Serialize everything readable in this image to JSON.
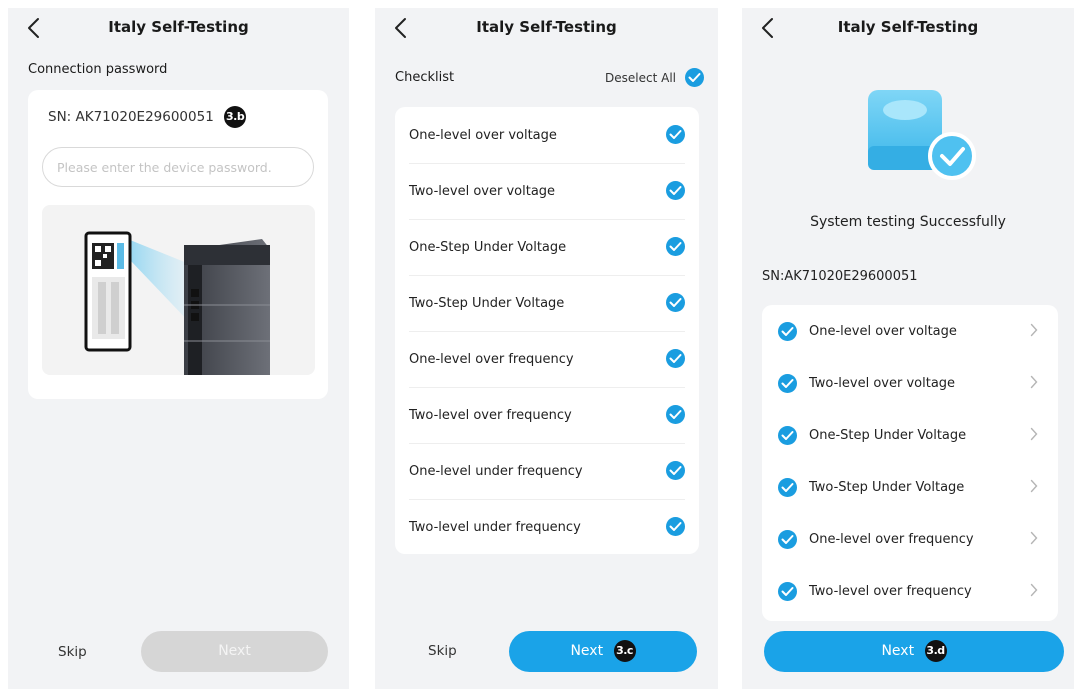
{
  "screens": {
    "password": {
      "title": "Italy Self-Testing",
      "section_label": "Connection password",
      "sn_text": "SN: AK71020E29600051",
      "badge": "3.b",
      "password_placeholder": "Please enter the device password.",
      "skip_label": "Skip",
      "next_label": "Next"
    },
    "checklist": {
      "title": "Italy Self-Testing",
      "section_label": "Checklist",
      "deselect_label": "Deselect All",
      "items": [
        "One-level over voltage",
        "Two-level over voltage",
        "One-Step Under Voltage",
        "Two-Step Under Voltage",
        "One-level over frequency",
        "Two-level over frequency",
        "One-level under frequency",
        "Two-level under frequency"
      ],
      "skip_label": "Skip",
      "next_label": "Next",
      "badge": "3.c"
    },
    "result": {
      "title": "Italy Self-Testing",
      "status_text": "System testing Successfully",
      "sn_text": "SN:AK71020E29600051",
      "items": [
        "One-level over voltage",
        "Two-level over voltage",
        "One-Step Under Voltage",
        "Two-Step Under Voltage",
        "One-level over frequency",
        "Two-level over frequency"
      ],
      "next_label": "Next",
      "badge": "3.d"
    }
  },
  "icons": {
    "back": "chevron-left-icon",
    "check": "check-circle-icon",
    "chevron": "chevron-right-icon"
  },
  "colors": {
    "accent": "#1aa3e8",
    "check": "#1a9de0",
    "disabled": "#d6d6d6",
    "background": "#f2f3f5"
  }
}
